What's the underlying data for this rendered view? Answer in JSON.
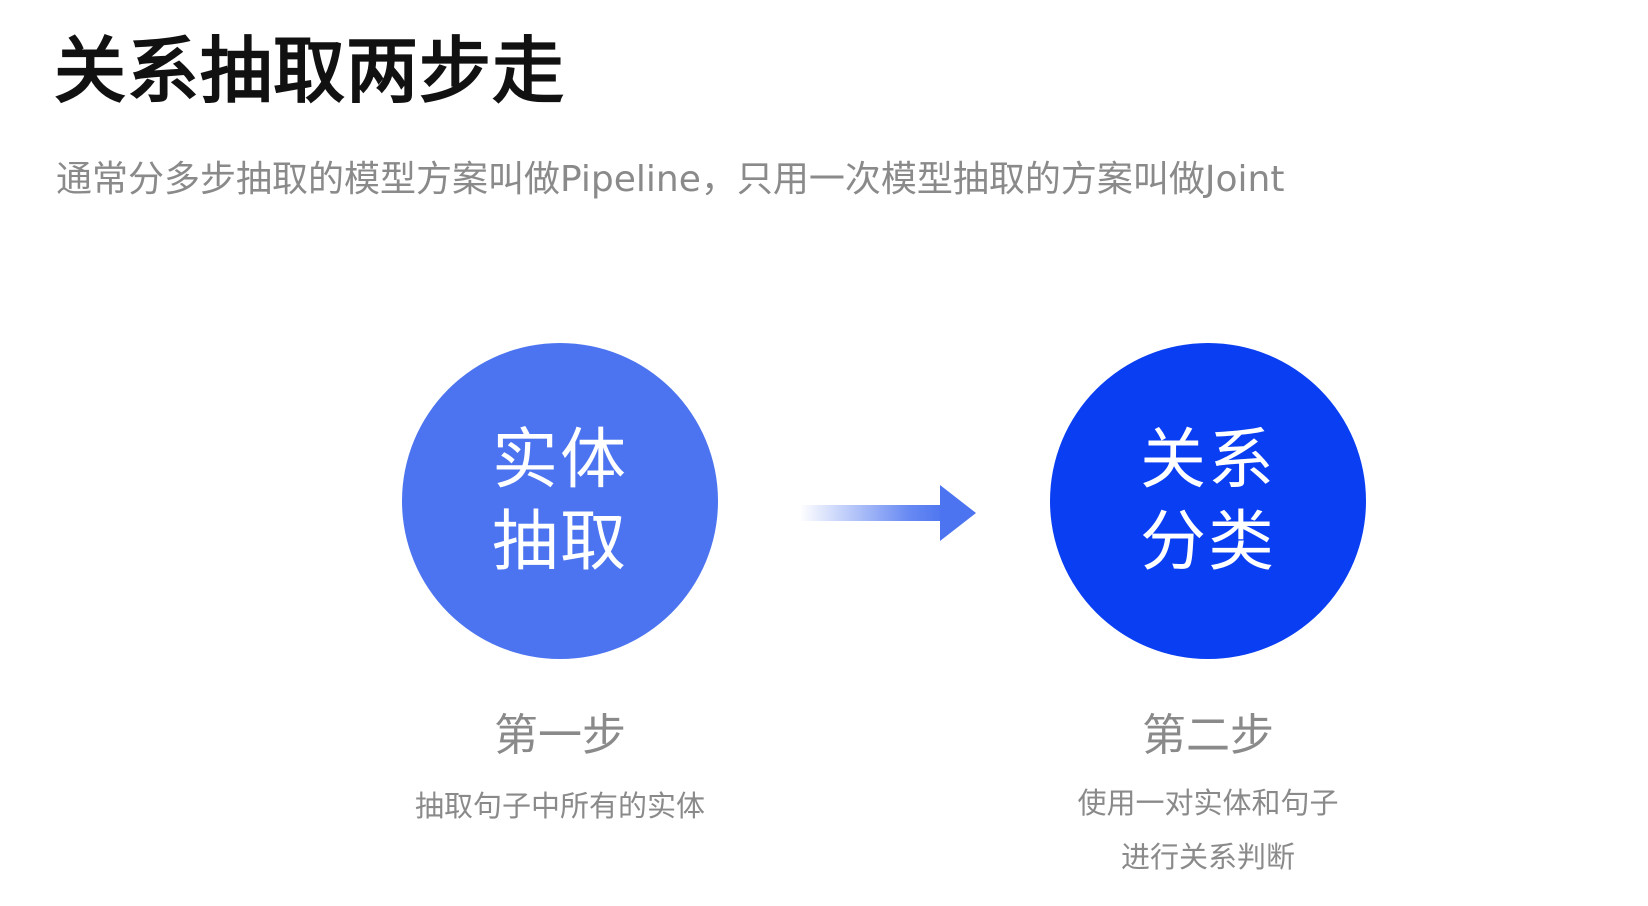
{
  "slide": {
    "title": "关系抽取两步走",
    "subtitle": "通常分多步抽取的模型方案叫做Pipeline，只用一次模型抽取的方案叫做Joint"
  },
  "steps": [
    {
      "circle_lines": [
        "实体",
        "抽取"
      ],
      "label": "第一步",
      "description_lines": [
        "抽取句子中所有的实体"
      ],
      "color": "#4c74f0"
    },
    {
      "circle_lines": [
        "关系",
        "分类"
      ],
      "label": "第二步",
      "description_lines": [
        "使用一对实体和句子",
        "进行关系判断"
      ],
      "color": "#0a3ef2"
    }
  ],
  "connector": {
    "icon": "right-arrow-icon",
    "color": "#4c74f0"
  }
}
